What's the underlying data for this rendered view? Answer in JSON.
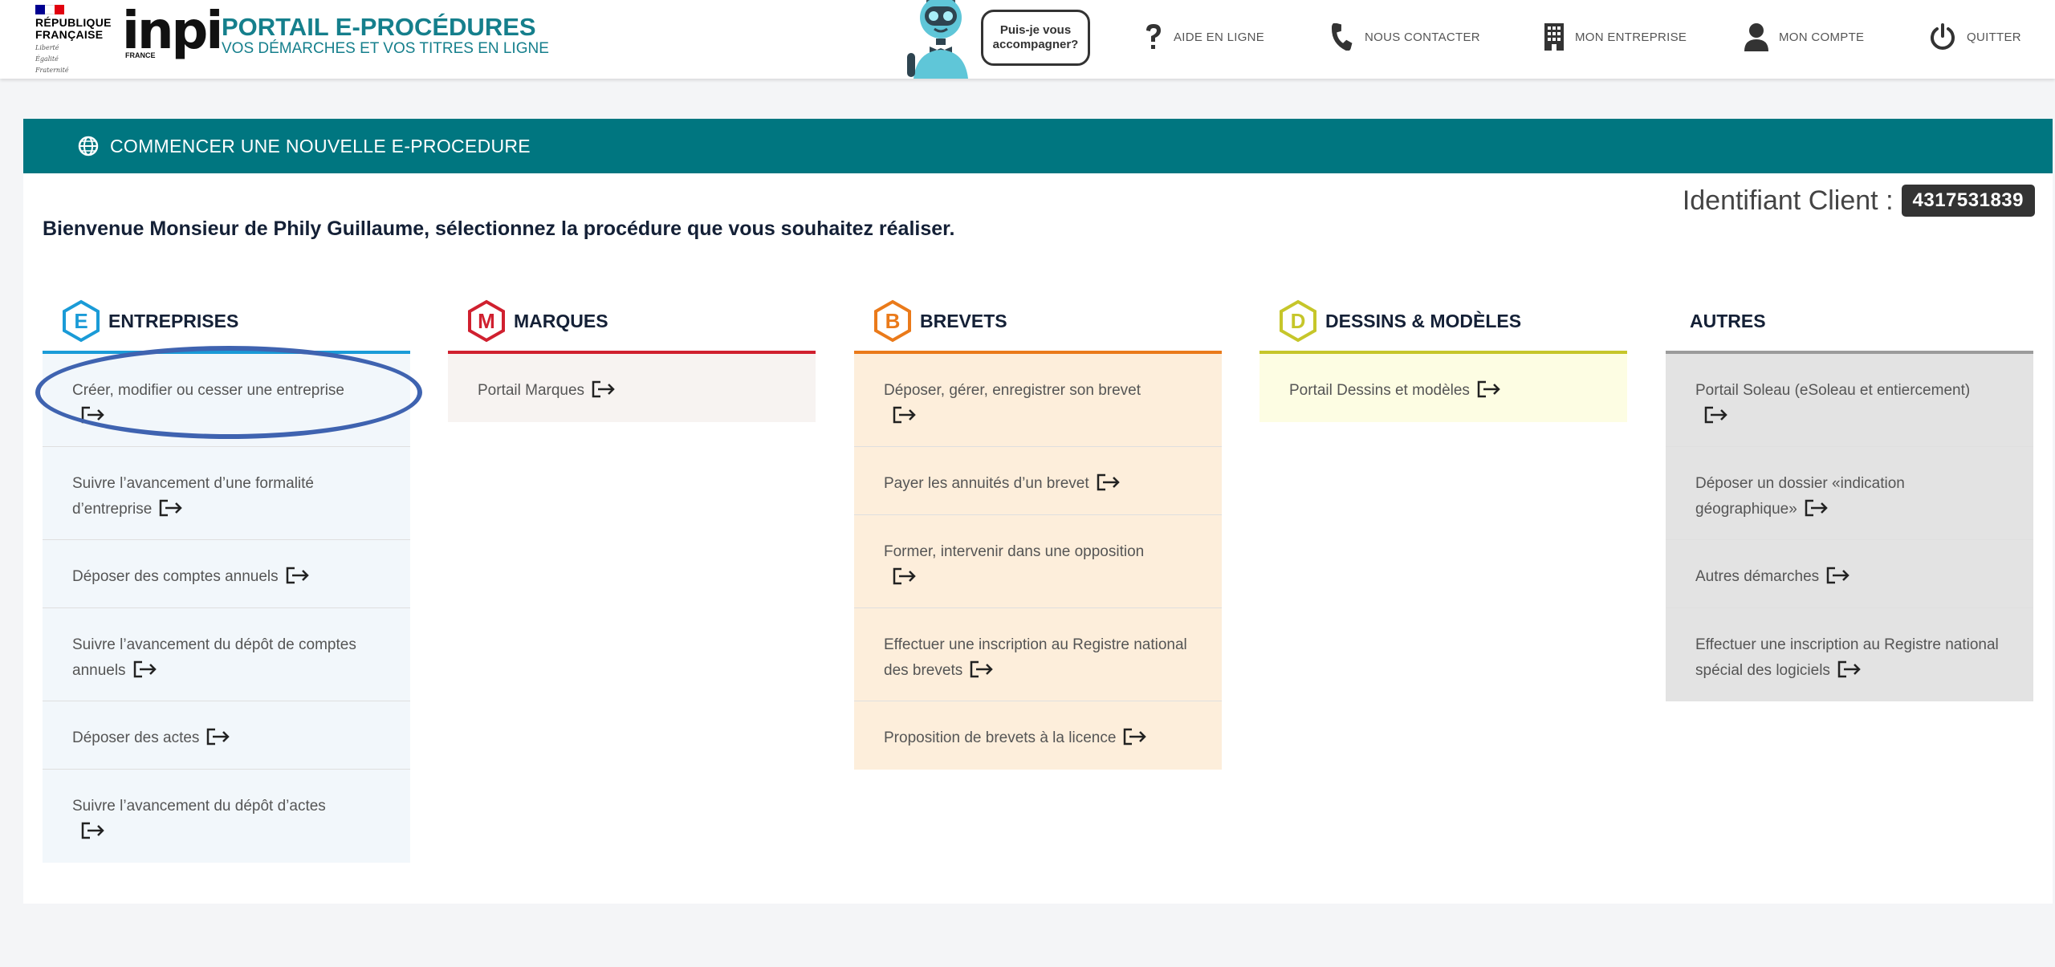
{
  "header": {
    "republique": [
      "RÉPUBLIQUE",
      "FRANÇAISE"
    ],
    "devise": [
      "Liberté",
      "Égalité",
      "Fraternité"
    ],
    "logo_word": "inpi",
    "logo_country": "FRANCE",
    "portal_title": "PORTAIL E-PROCÉDURES",
    "portal_subtitle": "VOS DÉMARCHES ET VOS TITRES EN LIGNE",
    "bubble": "Puis-je vous accompagner?",
    "nav": [
      {
        "label": "AIDE EN LIGNE",
        "icon": "question-icon"
      },
      {
        "label": "NOUS CONTACTER",
        "icon": "phone-icon"
      },
      {
        "label": "MON ENTREPRISE",
        "icon": "building-icon"
      },
      {
        "label": "MON COMPTE",
        "icon": "user-icon"
      },
      {
        "label": "QUITTER",
        "icon": "power-icon"
      }
    ]
  },
  "banner": {
    "label": "COMMENCER UNE NOUVELLE E-PROCEDURE",
    "icon": "globe-icon"
  },
  "client": {
    "label": "Identifiant Client :",
    "id": "4317531839"
  },
  "welcome": "Bienvenue Monsieur de Phily Guillaume, sélectionnez la procédure que vous souhaitez réaliser.",
  "colors": {
    "teal": "#007680",
    "entreprises": "#1a9bd7",
    "marques": "#d0202f",
    "brevets": "#ea7a1a",
    "dessins": "#c6c62a",
    "autres": "#9b9b9b",
    "highlight": "#3f63b0"
  },
  "columns": [
    {
      "key": "entreprises",
      "letter": "E",
      "title": "ENTREPRISES",
      "items": [
        "Créer, modifier ou cesser une entreprise",
        "Suivre l’avancement d’une formalité d’entreprise",
        "Déposer des comptes annuels",
        "Suivre l’avancement du dépôt de comptes annuels",
        "Déposer des actes",
        "Suivre l’avancement du dépôt d’actes"
      ]
    },
    {
      "key": "marques",
      "letter": "M",
      "title": "MARQUES",
      "items": [
        "Portail Marques"
      ]
    },
    {
      "key": "brevets",
      "letter": "B",
      "title": "BREVETS",
      "items": [
        "Déposer, gérer, enregistrer son brevet",
        "Payer les annuités d’un brevet",
        "Former, intervenir dans une opposition",
        "Effectuer une inscription au Registre national des brevets",
        "Proposition de brevets à la licence"
      ]
    },
    {
      "key": "dessins",
      "letter": "D",
      "title": "DESSINS & MODÈLES",
      "items": [
        "Portail Dessins et modèles"
      ]
    },
    {
      "key": "autres",
      "letter": "",
      "title": "AUTRES",
      "items": [
        "Portail Soleau (eSoleau et entiercement)",
        "Déposer un dossier «indication géographique»",
        "Autres démarches",
        "Effectuer une inscription au Registre national spécial des logiciels"
      ]
    }
  ]
}
